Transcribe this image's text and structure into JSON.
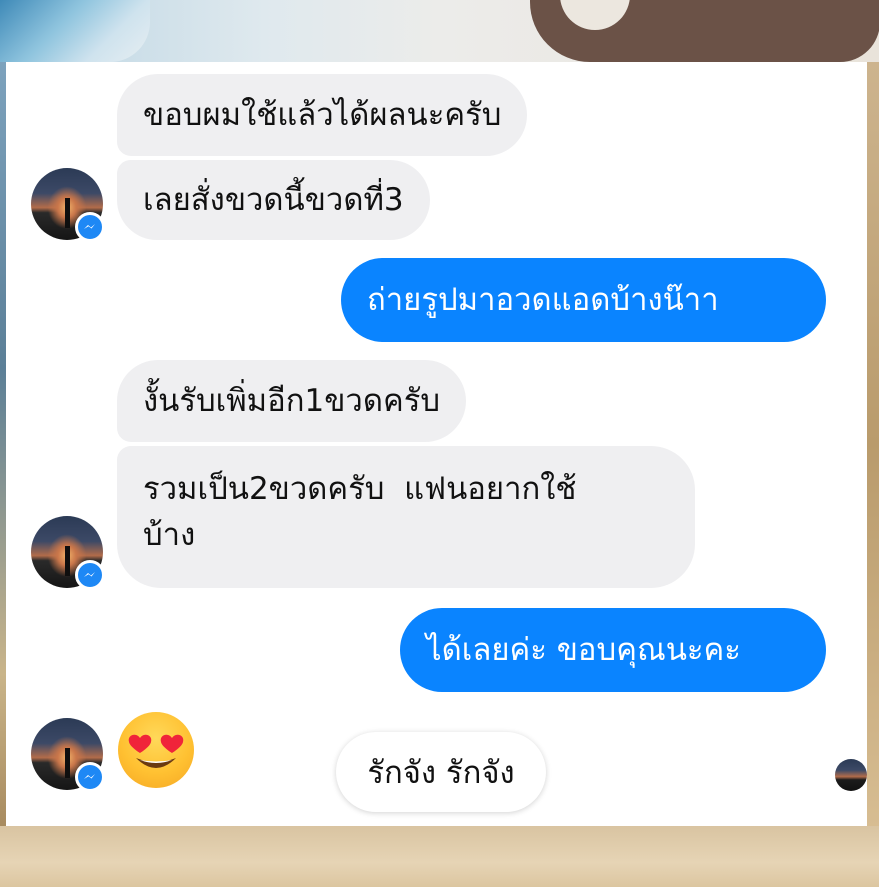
{
  "messages": [
    {
      "direction": "incoming",
      "text": "ขอบผมใช้แล้วได้ผลนะครับ"
    },
    {
      "direction": "incoming",
      "text": "เลยสั่งขวดนี้ขวดที่3"
    },
    {
      "direction": "outgoing",
      "text": "ถ่ายรูปมาอวดแอดบ้างน๊าา"
    },
    {
      "direction": "incoming",
      "text": "งั้นรับเพิ่มอีก1ขวดครับ"
    },
    {
      "direction": "incoming",
      "lines": [
        "รวมเป็น2ขวดครับ  แฟนอยากใช้",
        "บ้าง"
      ]
    },
    {
      "direction": "outgoing",
      "text": "ได้เลยค่ะ ขอบคุณนะคะ"
    },
    {
      "direction": "incoming",
      "emoji": "heart-eyes-emoji"
    },
    {
      "direction": "incoming",
      "text": "รักจัง รักจัง"
    }
  ],
  "icons": {
    "messenger_badge": "messenger-icon",
    "emoji": "heart-eyes-emoji"
  },
  "colors": {
    "outgoing_bubble": "#0a84ff",
    "incoming_bubble": "#efeff1",
    "messenger_badge": "#1e88f5"
  }
}
